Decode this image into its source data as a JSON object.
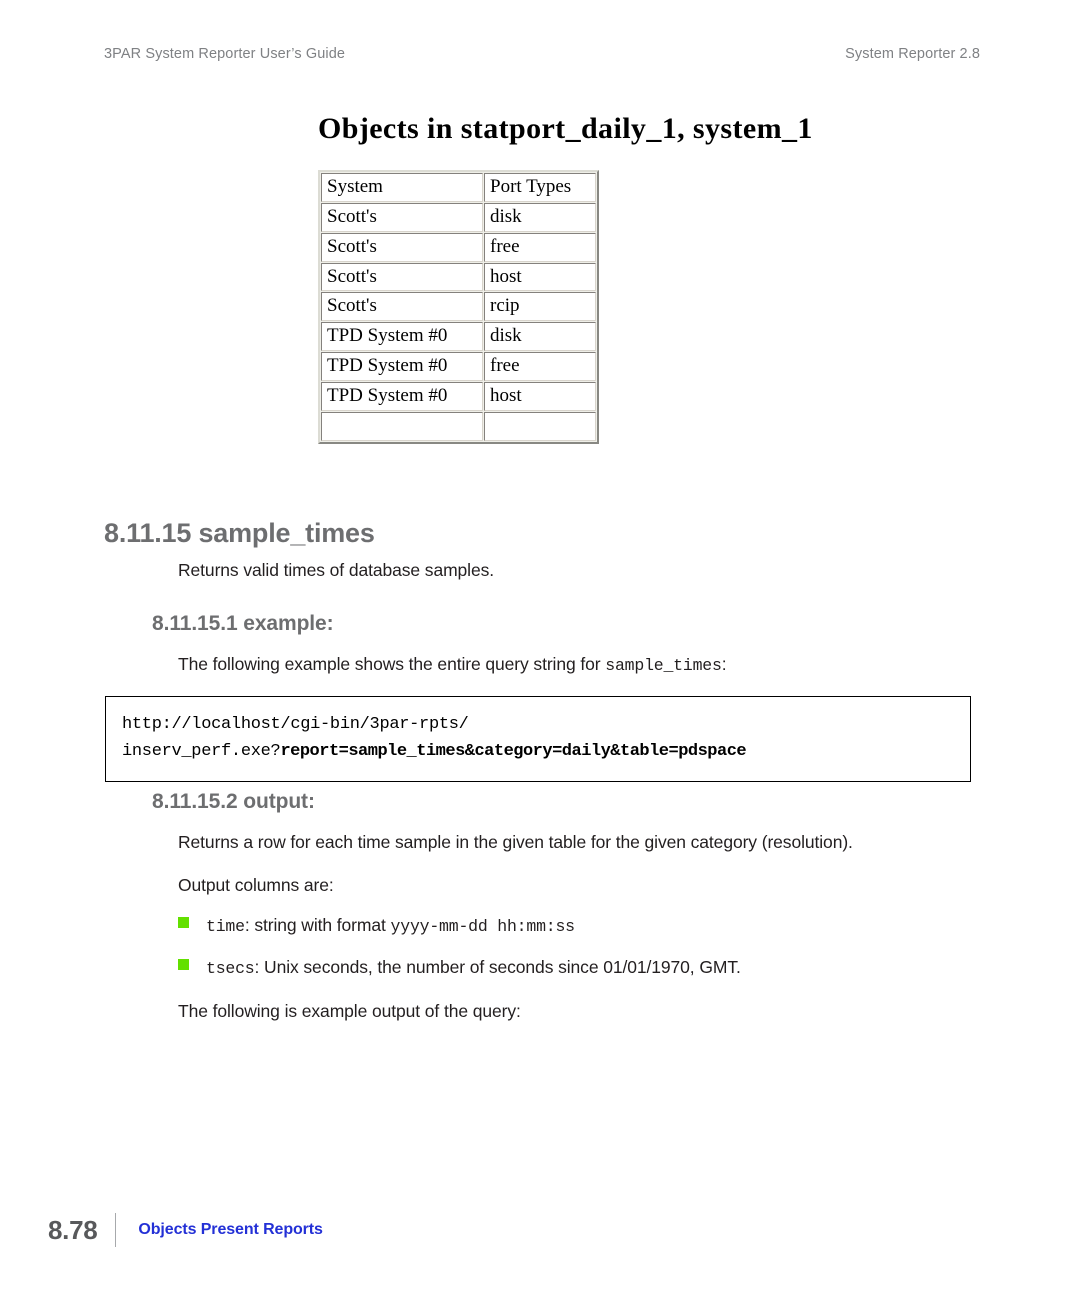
{
  "running_head": {
    "left": "3PAR System Reporter User’s Guide",
    "right": "System Reporter 2.8"
  },
  "figure": {
    "title": "Objects in statport_daily_1, system_1",
    "table": {
      "headers": [
        "System",
        "Port Types"
      ],
      "rows": [
        [
          "Scott's",
          "disk"
        ],
        [
          "Scott's",
          "free"
        ],
        [
          "Scott's",
          "host"
        ],
        [
          "Scott's",
          "rcip"
        ],
        [
          "TPD System #0",
          "disk"
        ],
        [
          "TPD System #0",
          "free"
        ],
        [
          "TPD System #0",
          "host"
        ],
        [
          "",
          ""
        ]
      ]
    }
  },
  "section": {
    "heading": "8.11.15 sample_times",
    "intro": "Returns valid times of database samples."
  },
  "example": {
    "heading": "8.11.15.1 example:",
    "lead_before": "The following example shows the entire query string for ",
    "lead_code": "sample_times",
    "lead_after": ":",
    "code_line1": "http://localhost/cgi-bin/3par-rpts/",
    "code_line2_plain": "inserv_perf.exe?",
    "code_line2_bold": "report=sample_times&category=daily&table=pdspace"
  },
  "output": {
    "heading": "8.11.15.2 output:",
    "para1": "Returns a row for each time sample in the given table for the given category (resolution).",
    "para2": "Output columns are:",
    "bullets": [
      {
        "code": "time",
        "mid": ": string with format ",
        "code2": "yyyy-mm-dd hh:mm:ss",
        "tail": ""
      },
      {
        "code": "tsecs",
        "mid": ": Unix seconds, the number of seconds since 01/01/1970, GMT.",
        "code2": "",
        "tail": ""
      }
    ],
    "closing": "The following is example output of the query:"
  },
  "footer": {
    "page_number": "8.78",
    "section_label": "Objects Present Reports"
  },
  "colors": {
    "bullet_green": "#63e000",
    "footer_blue": "#2330d6",
    "heading_gray": "#6d6e70",
    "running_head_gray": "#7f8184"
  }
}
